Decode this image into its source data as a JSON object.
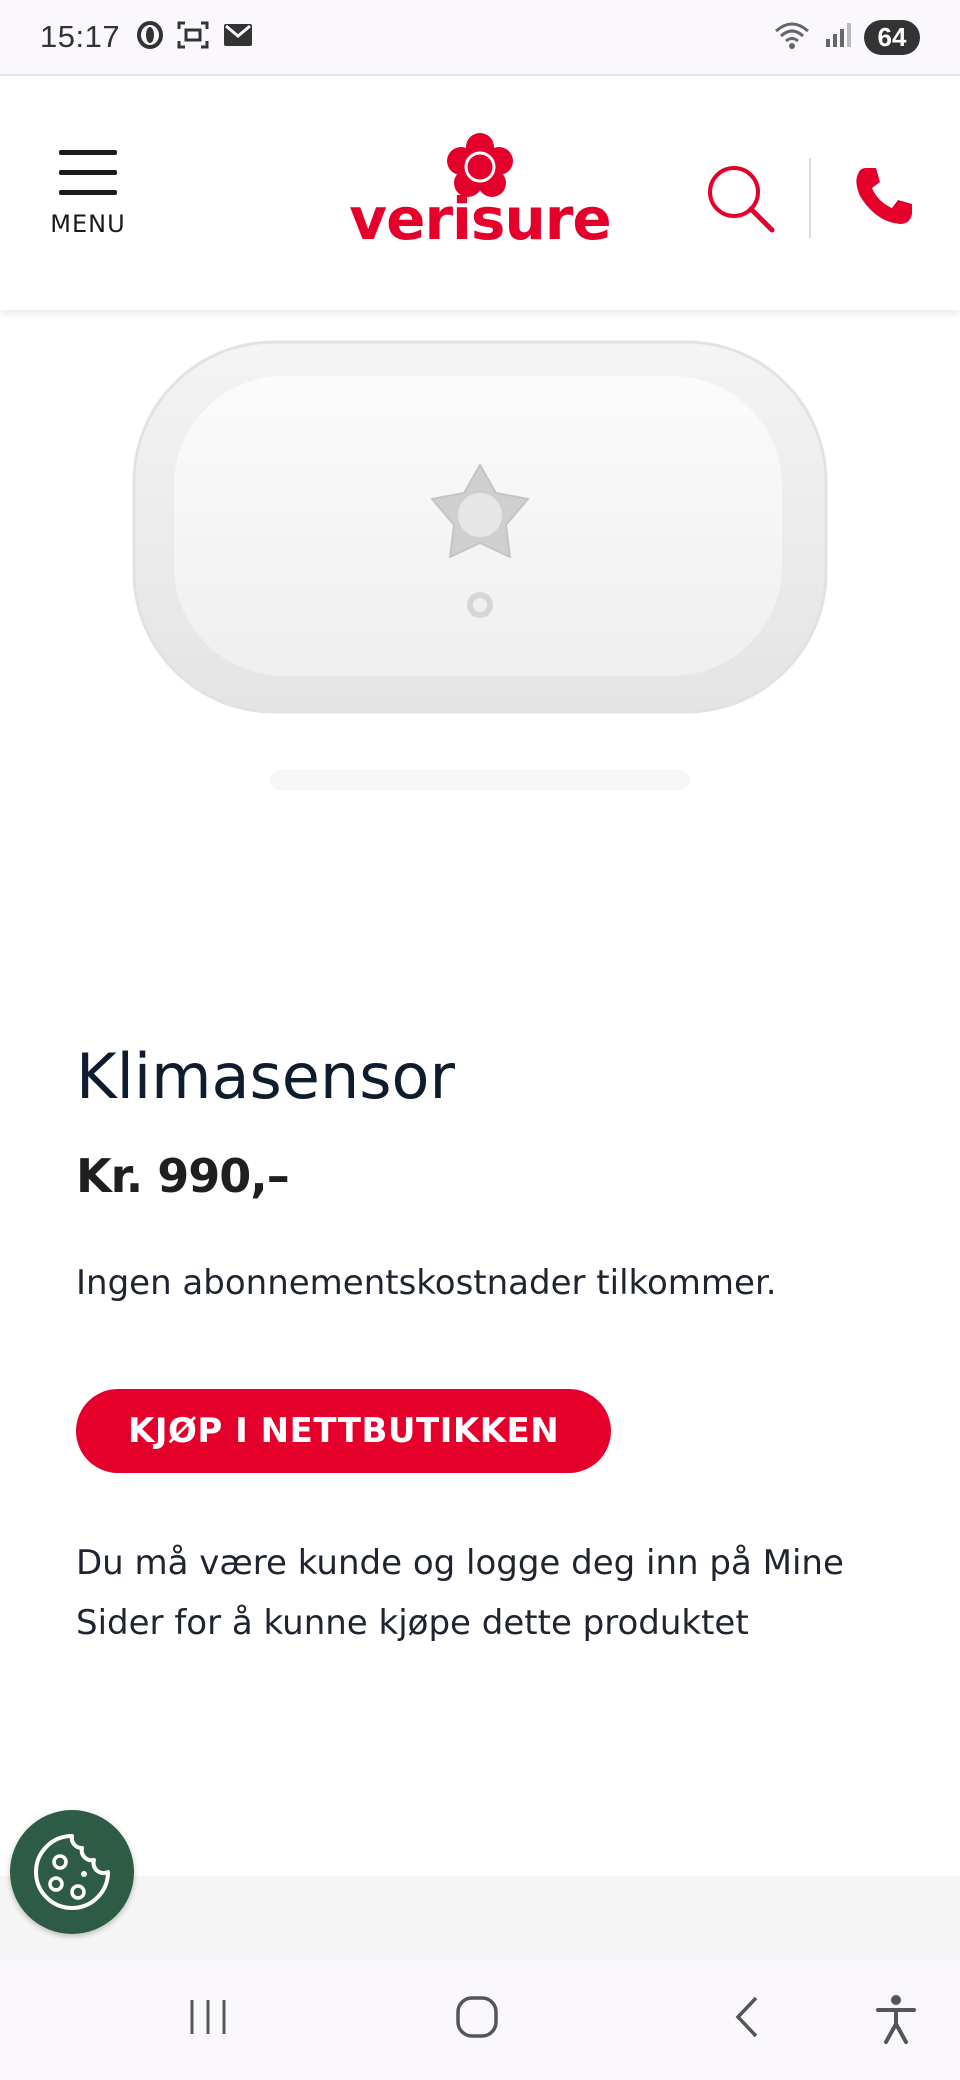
{
  "status_bar": {
    "time": "15:17",
    "battery": "64",
    "icons": [
      "opera-icon",
      "screenshot-icon",
      "gmail-icon",
      "wifi-icon",
      "signal-icon",
      "battery-icon"
    ]
  },
  "header": {
    "menu_label": "MENU",
    "logo_text": "verisure",
    "icons": [
      "menu-icon",
      "search-icon",
      "phone-icon"
    ],
    "brand_color": "#e4002b"
  },
  "product": {
    "title": "Klimasensor",
    "price": "Kr. 990,–",
    "note": "Ingen abonnementskostnader tilkommer.",
    "buy_button": "KJØP I NETTBUTIKKEN",
    "login_note": "Du må være kunde og logge deg inn på Mine Sider for å kunne kjøpe dette produktet"
  },
  "cookie": {
    "icon": "cookie-icon",
    "color": "#2e5b45"
  },
  "nav_bar": {
    "icons": [
      "recent-apps-icon",
      "home-icon",
      "back-icon",
      "accessibility-icon"
    ]
  }
}
